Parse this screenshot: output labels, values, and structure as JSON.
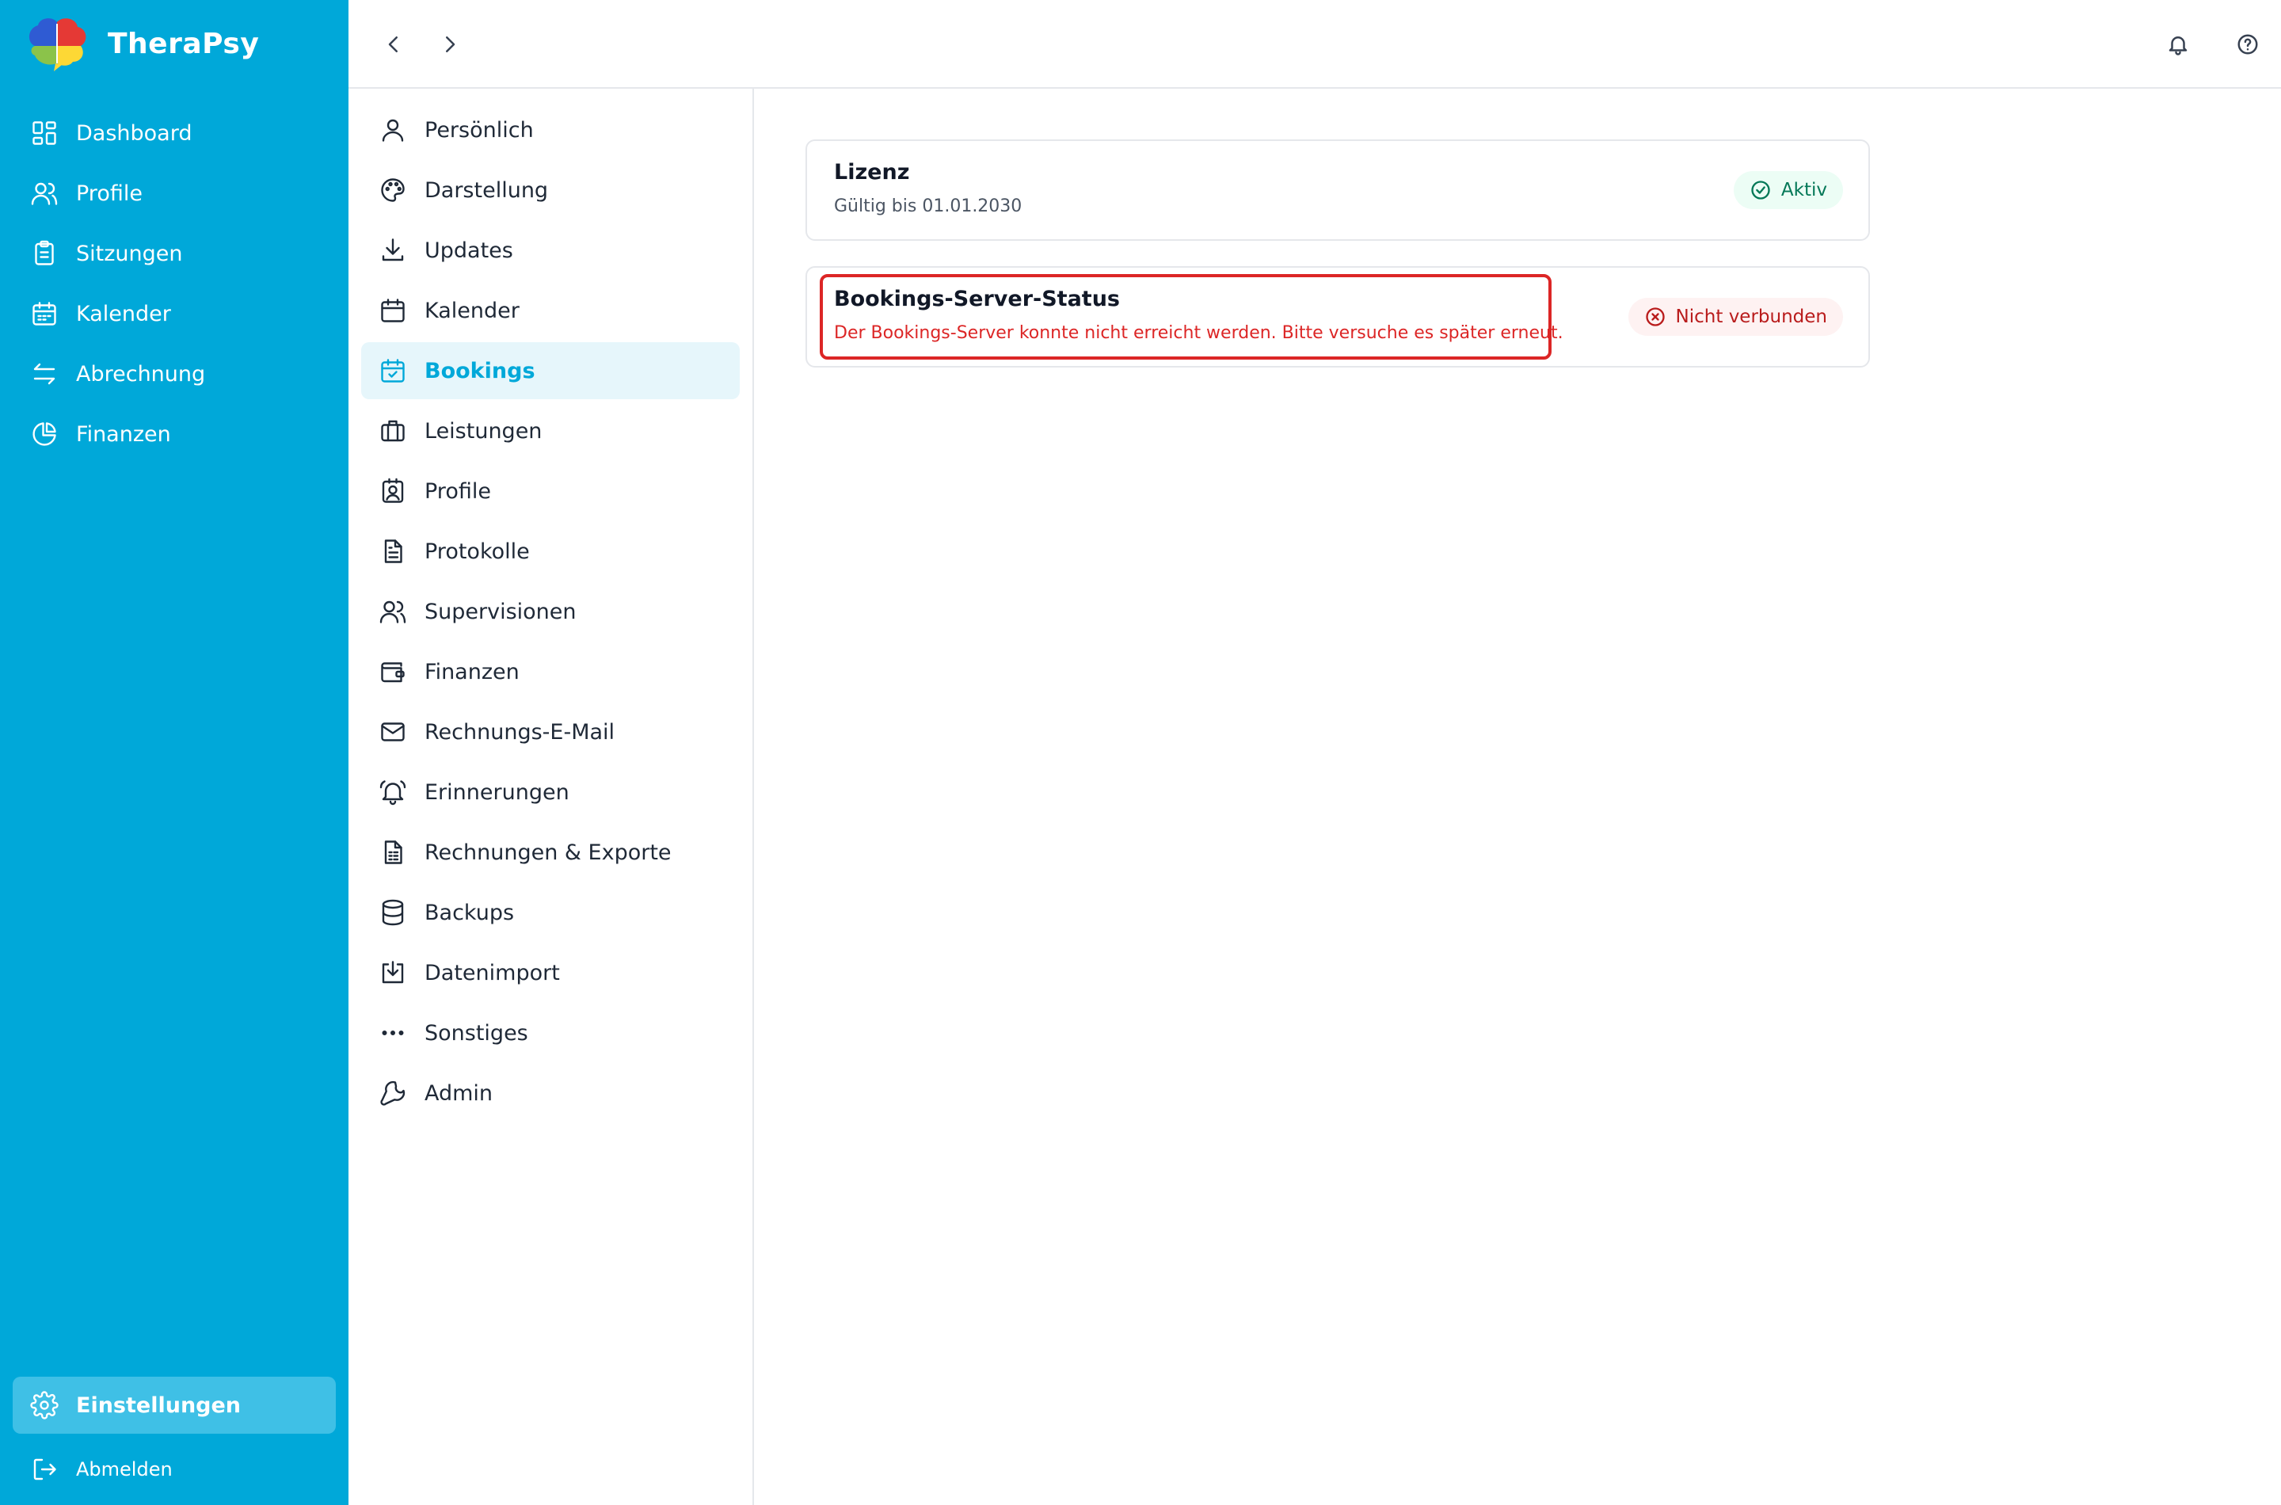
{
  "app": {
    "name": "TheraPsy"
  },
  "sidebar": {
    "items": [
      {
        "label": "Dashboard",
        "icon": "dashboard-icon"
      },
      {
        "label": "Profile",
        "icon": "users-icon"
      },
      {
        "label": "Sitzungen",
        "icon": "clipboard-icon"
      },
      {
        "label": "Kalender",
        "icon": "calendar-icon"
      },
      {
        "label": "Abrechnung",
        "icon": "arrows-swap-icon"
      },
      {
        "label": "Finanzen",
        "icon": "pie-chart-icon"
      }
    ],
    "settings_label": "Einstellungen",
    "logout_label": "Abmelden",
    "active": "Einstellungen"
  },
  "topbar": {
    "back_icon": "chevron-left-icon",
    "forward_icon": "chevron-right-icon",
    "notifications_icon": "bell-icon",
    "help_icon": "help-circle-icon"
  },
  "settings_nav": {
    "active": "Bookings",
    "items": [
      {
        "label": "Persönlich",
        "icon": "user-icon"
      },
      {
        "label": "Darstellung",
        "icon": "palette-icon"
      },
      {
        "label": "Updates",
        "icon": "download-icon"
      },
      {
        "label": "Kalender",
        "icon": "calendar-icon"
      },
      {
        "label": "Bookings",
        "icon": "calendar-check-icon"
      },
      {
        "label": "Leistungen",
        "icon": "briefcase-icon"
      },
      {
        "label": "Profile",
        "icon": "contact-icon"
      },
      {
        "label": "Protokolle",
        "icon": "document-icon"
      },
      {
        "label": "Supervisionen",
        "icon": "users-icon"
      },
      {
        "label": "Finanzen",
        "icon": "wallet-icon"
      },
      {
        "label": "Rechnungs-E-Mail",
        "icon": "mail-icon"
      },
      {
        "label": "Erinnerungen",
        "icon": "bell-ring-icon"
      },
      {
        "label": "Rechnungen & Exporte",
        "icon": "spreadsheet-icon"
      },
      {
        "label": "Backups",
        "icon": "database-icon"
      },
      {
        "label": "Datenimport",
        "icon": "import-icon"
      },
      {
        "label": "Sonstiges",
        "icon": "ellipsis-icon"
      },
      {
        "label": "Admin",
        "icon": "wrench-icon"
      }
    ]
  },
  "license_card": {
    "title": "Lizenz",
    "subtitle": "Gültig bis 01.01.2030",
    "status": "Aktiv",
    "status_color": "#047857"
  },
  "server_card": {
    "title": "Bookings-Server-Status",
    "error": "Der Bookings-Server konnte nicht erreicht werden. Bitte versuche es später erneut.",
    "status": "Nicht verbunden",
    "status_color": "#b91c1c",
    "highlight_color": "#dc2626"
  },
  "colors": {
    "sidebar_bg": "#00a8d9",
    "accent": "#00a8d9",
    "active_subnav_bg": "#e6f6fb"
  }
}
